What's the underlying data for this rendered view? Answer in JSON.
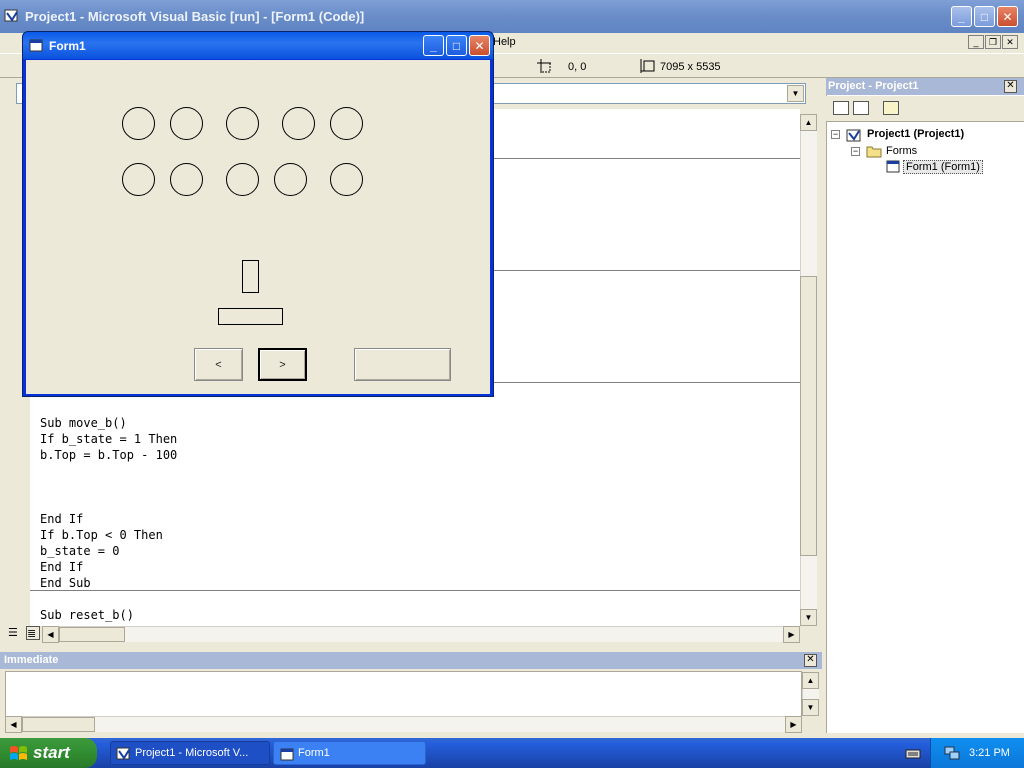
{
  "main_window": {
    "title": "Project1 - Microsoft Visual Basic [run] - [Form1 (Code)]",
    "menu_help": "Help",
    "position_readout": "0, 0",
    "size_readout": "7095 x 5535"
  },
  "code": {
    "lines": [
      "Sub move_b()",
      "If b_state = 1 Then",
      "b.Top = b.Top - 100",
      "End If",
      "If b.Top < 0 Then",
      "b_state = 0",
      "End If",
      "End Sub",
      "Sub reset_b()"
    ]
  },
  "project": {
    "title": "Project - Project1",
    "root": "Project1 (Project1)",
    "folder": "Forms",
    "form": "Form1 (Form1)"
  },
  "immediate": {
    "title": "Immediate"
  },
  "form1": {
    "title": "Form1",
    "left_label": "<",
    "right_label": ">",
    "third_label": ""
  },
  "taskbar": {
    "start": "start",
    "task1": "Project1 - Microsoft V...",
    "task2": "Form1",
    "clock": "3:21 PM"
  },
  "colors": {
    "xp_blue": "#0a5ae8",
    "taskbar_blue": "#245edb",
    "start_green": "#2f8a2f",
    "inactive_title": "#7b9cdc"
  }
}
